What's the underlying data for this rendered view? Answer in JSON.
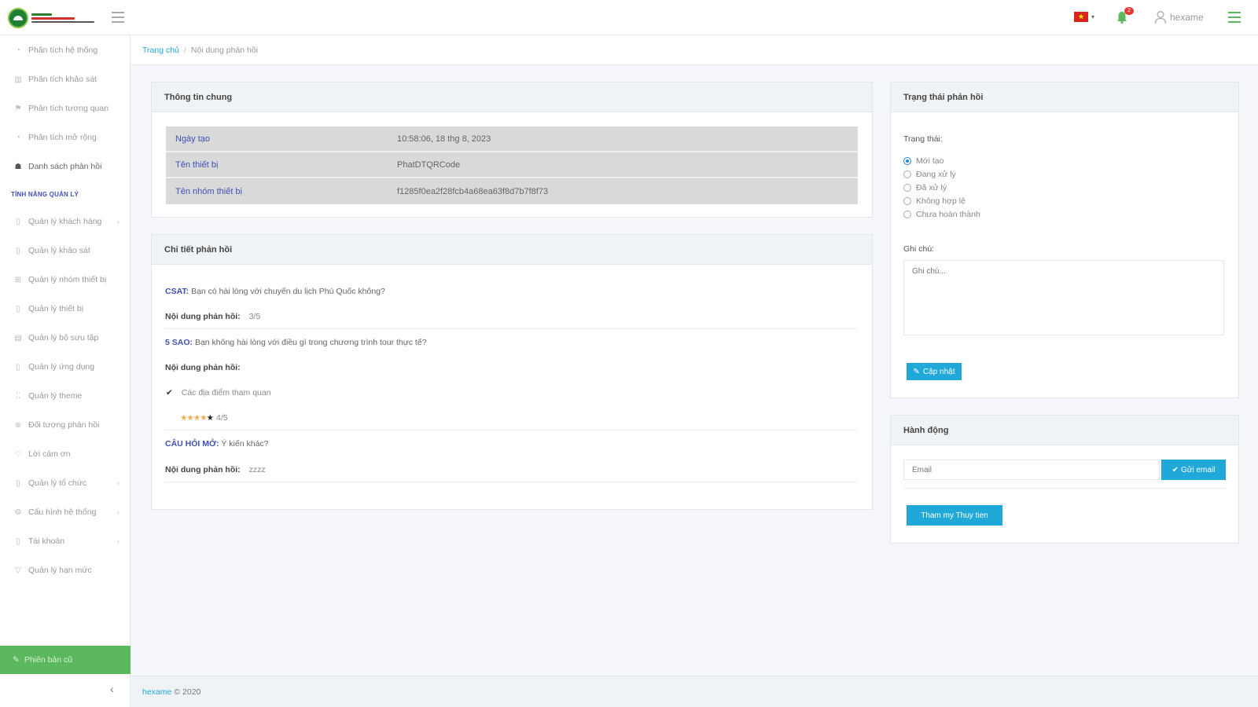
{
  "header": {
    "flag_star": "★",
    "caret": "▾",
    "notification_count": "2",
    "username": "hexame"
  },
  "sidebar": {
    "items": [
      {
        "label": "Phân tích hệ thống",
        "icon": "◔"
      },
      {
        "label": "Phân tích khảo sát",
        "icon": "▥"
      },
      {
        "label": "Phân tích tương quan",
        "icon": "⚑"
      },
      {
        "label": "Phân tích mở rộng",
        "icon": "◔"
      },
      {
        "label": "Danh sách phản hồi",
        "icon": "☗"
      }
    ],
    "section_heading": "TÍNH NĂNG QUẢN LÝ",
    "mgmt_items": [
      {
        "label": "Quản lý khách hàng",
        "icon": "▯",
        "chevron": "‹"
      },
      {
        "label": "Quản lý khảo sát",
        "icon": "▯",
        "chevron": ""
      },
      {
        "label": "Quản lý nhóm thiết bị",
        "icon": "⊞",
        "chevron": ""
      },
      {
        "label": "Quản lý thiết bị",
        "icon": "▯",
        "chevron": ""
      },
      {
        "label": "Quản lý bộ sưu tập",
        "icon": "▤",
        "chevron": ""
      },
      {
        "label": "Quản lý ứng dụng",
        "icon": "▯",
        "chevron": ""
      },
      {
        "label": "Quản lý theme",
        "icon": "⁚⁚",
        "chevron": ""
      },
      {
        "label": "Đối tượng phản hồi",
        "icon": "⊕",
        "chevron": ""
      },
      {
        "label": "Lời cảm ơn",
        "icon": "♡",
        "chevron": ""
      },
      {
        "label": "Quản lý tổ chức",
        "icon": "▯",
        "chevron": "‹"
      },
      {
        "label": "Cấu hình hệ thống",
        "icon": "⚙",
        "chevron": "‹"
      },
      {
        "label": "Tài khoản",
        "icon": "▯",
        "chevron": "‹"
      },
      {
        "label": "Quản lý hạn mức",
        "icon": "▽",
        "chevron": ""
      }
    ],
    "bottom_label": "Phiên bản cũ",
    "bottom_icon": "✎",
    "collapse_icon": "‹"
  },
  "breadcrumb": {
    "home": "Trang chủ",
    "separator": "/",
    "current": "Nội dung phản hồi"
  },
  "general_info": {
    "title": "Thông tin chung",
    "rows": [
      {
        "key": "Ngày tạo",
        "value": "10:58:06, 18 thg 8, 2023"
      },
      {
        "key": "Tên thiết bị",
        "value": "PhatDTQRCode"
      },
      {
        "key": "Tên nhóm thiết bị",
        "value": "f1285f0ea2f28fcb4a68ea63f8d7b7f8f73"
      }
    ]
  },
  "detail": {
    "title": "Chi tiết phản hồi",
    "q1_tag": "CSAT:",
    "q1_text": "Bạn có hài lòng với chuyến du lịch Phú Quốc không?",
    "answer_label": "Nội dung phản hồi:",
    "q1_answer": "3/5",
    "q2_tag": "5 SAO:",
    "q2_text": "Bạn không hài lòng với điều gì trong chương trình tour thực tế?",
    "q2_choice": "Các địa điểm tham quan",
    "check_icon": "✔",
    "stars_filled": "★★★★",
    "stars_empty": "★",
    "q2_rating": "4/5",
    "q3_tag": "CÂU HỎI MỞ:",
    "q3_text": "Ý kiến khác?",
    "q3_answer": "zzzz"
  },
  "status": {
    "title": "Trạng thái phản hồi",
    "status_label": "Trạng thái:",
    "options": [
      "Mới tạo",
      "Đang xử lý",
      "Đã xử lý",
      "Không hợp lệ",
      "Chưa hoàn thành"
    ],
    "selected_index": 0,
    "note_label": "Ghi chú:",
    "note_placeholder": "Ghi chú...",
    "save_icon": "✎",
    "save_label": "Cập nhật"
  },
  "actions": {
    "title": "Hành động",
    "email_placeholder": "Email",
    "send_icon": "✔",
    "send_label": "Gửi email",
    "view_label": "Tham my Thuy tien"
  },
  "footer": {
    "brand": "hexame",
    "copyright": "© 2020"
  },
  "colors": {
    "accent": "#20a8d8",
    "link": "#3f51b5",
    "success": "#5cb85c",
    "danger": "#da251d"
  }
}
